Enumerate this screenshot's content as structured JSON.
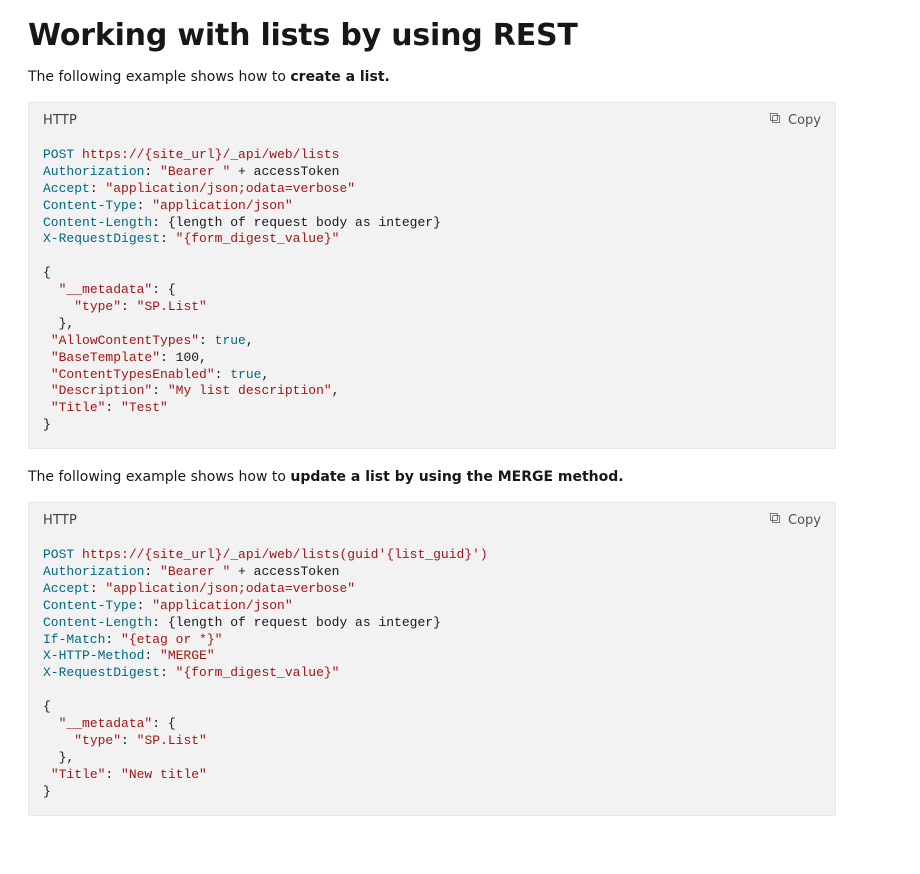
{
  "title": "Working with lists by using REST",
  "para1_prefix": "The following example shows how to ",
  "para1_bold": "create a list.",
  "para2_prefix": "The following example shows how to ",
  "para2_bold": "update a list by using the MERGE method.",
  "codeLang": "HTTP",
  "copyLabel": "Copy",
  "block1": {
    "method": "POST",
    "url": "https://{site_url}/_api/web/lists",
    "headers": [
      {
        "name": "Authorization",
        "raw": "\"Bearer \" + accessToken"
      },
      {
        "name": "Accept",
        "value": "\"application/json;odata=verbose\""
      },
      {
        "name": "Content-Type",
        "value": "\"application/json\""
      },
      {
        "name": "Content-Length",
        "placeholder": "{length of request body as integer}"
      },
      {
        "name": "X-RequestDigest",
        "value": "\"{form_digest_value}\""
      }
    ],
    "body": {
      "__metadata": {
        "type": "SP.List"
      },
      "AllowContentTypes": true,
      "BaseTemplate": 100,
      "ContentTypesEnabled": true,
      "Description": "My list description",
      "Title": "Test"
    }
  },
  "block2": {
    "method": "POST",
    "url": "https://{site_url}/_api/web/lists(guid'{list_guid}')",
    "headers": [
      {
        "name": "Authorization",
        "raw": "\"Bearer \" + accessToken"
      },
      {
        "name": "Accept",
        "value": "\"application/json;odata=verbose\""
      },
      {
        "name": "Content-Type",
        "value": "\"application/json\""
      },
      {
        "name": "Content-Length",
        "placeholder": "{length of request body as integer}"
      },
      {
        "name": "If-Match",
        "value": "\"{etag or *}\""
      },
      {
        "name": "X-HTTP-Method",
        "value": "\"MERGE\""
      },
      {
        "name": "X-RequestDigest",
        "value": "\"{form_digest_value}\""
      }
    ],
    "body": {
      "__metadata": {
        "type": "SP.List"
      },
      "Title": "New title"
    }
  }
}
